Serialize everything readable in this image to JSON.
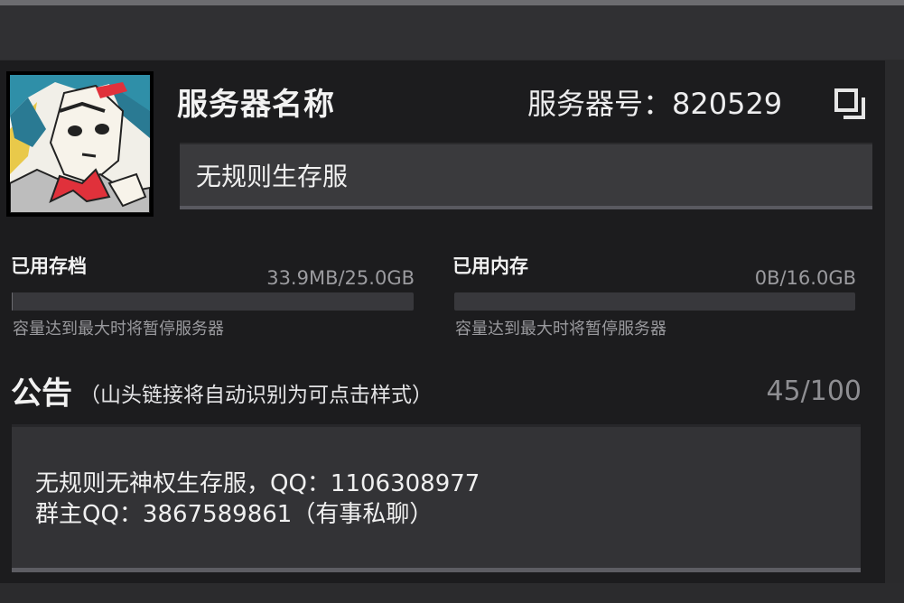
{
  "header": {
    "server_name_label": "服务器名称",
    "server_number_text": "服务器号：820529"
  },
  "icons": {
    "copy": "copy-icon"
  },
  "name_field": {
    "value": "无规则生存服"
  },
  "storage": {
    "label": "已用存档",
    "value": "33.9MB/25.0GB",
    "hint": "容量达到最大时将暂停服务器"
  },
  "memory": {
    "label": "已用内存",
    "value": "0B/16.0GB",
    "hint": "容量达到最大时将暂停服务器"
  },
  "notice": {
    "title": "公告",
    "subtitle": "（山头链接将自动识别为可点击样式）",
    "count": "45/100",
    "lines": [
      "无规则无神权生存服，QQ：1106308977",
      "群主QQ：3867589861（有事私聊）"
    ]
  },
  "colors": {
    "panel": "#1c1c1e",
    "input_bg": "#3a3a3d",
    "accent_red": "#e0313b"
  }
}
